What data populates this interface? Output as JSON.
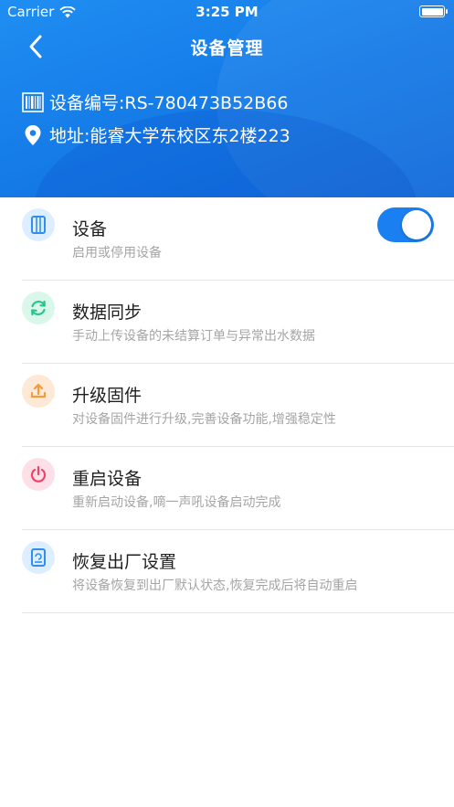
{
  "status_bar": {
    "carrier": "Carrier",
    "time": "3:25 PM"
  },
  "nav": {
    "title": "设备管理"
  },
  "device": {
    "id_text": "设备编号:RS-780473B52B66",
    "address_text": "地址:能睿大学东校区东2楼223"
  },
  "items": [
    {
      "title": "设备",
      "desc": "启用或停用设备",
      "icon": "device-icon",
      "color": "#2f8ef0",
      "bg": "#dceeff",
      "toggle_on": true
    },
    {
      "title": "数据同步",
      "desc": "手动上传设备的未结算订单与异常出水数据",
      "icon": "sync-icon",
      "color": "#27c58a",
      "bg": "#d9f7ea"
    },
    {
      "title": "升级固件",
      "desc": "对设备固件进行升级,完善设备功能,增强稳定性",
      "icon": "upload-icon",
      "color": "#f59b3a",
      "bg": "#fde9d5"
    },
    {
      "title": "重启设备",
      "desc": "重新启动设备,嘀一声吼设备启动完成",
      "icon": "power-icon",
      "color": "#f0426a",
      "bg": "#fde0e7"
    },
    {
      "title": "恢复出厂设置",
      "desc": "将设备恢复到出厂默认状态,恢复完成后将自动重启",
      "icon": "reset-icon",
      "color": "#2f8ef0",
      "bg": "#dceeff"
    }
  ]
}
